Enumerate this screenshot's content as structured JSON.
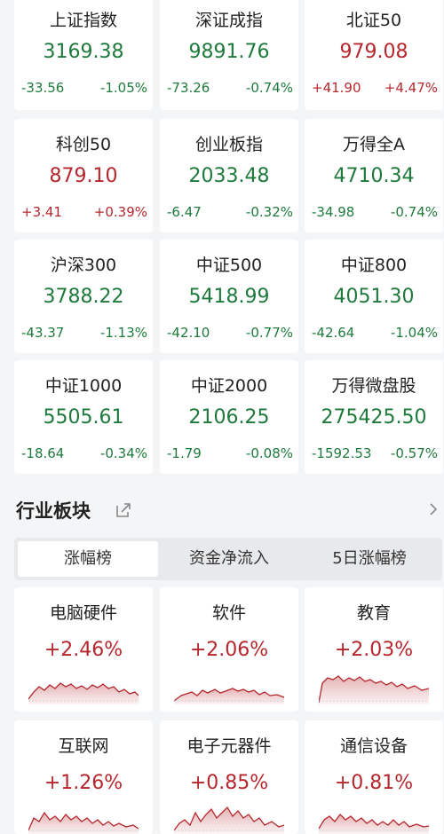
{
  "colors": {
    "up": "#b5272d",
    "down": "#1e7a3c",
    "background": "#f4f5f6"
  },
  "indices": [
    {
      "name": "上证指数",
      "value": "3169.38",
      "change": "-33.56",
      "pct": "-1.05%",
      "direction": "down"
    },
    {
      "name": "深证成指",
      "value": "9891.76",
      "change": "-73.26",
      "pct": "-0.74%",
      "direction": "down"
    },
    {
      "name": "北证50",
      "value": "979.08",
      "change": "+41.90",
      "pct": "+4.47%",
      "direction": "up"
    },
    {
      "name": "科创50",
      "value": "879.10",
      "change": "+3.41",
      "pct": "+0.39%",
      "direction": "up"
    },
    {
      "name": "创业板指",
      "value": "2033.48",
      "change": "-6.47",
      "pct": "-0.32%",
      "direction": "down"
    },
    {
      "name": "万得全A",
      "value": "4710.34",
      "change": "-34.98",
      "pct": "-0.74%",
      "direction": "down"
    },
    {
      "name": "沪深300",
      "value": "3788.22",
      "change": "-43.37",
      "pct": "-1.13%",
      "direction": "down"
    },
    {
      "name": "中证500",
      "value": "5418.99",
      "change": "-42.10",
      "pct": "-0.77%",
      "direction": "down"
    },
    {
      "name": "中证800",
      "value": "4051.30",
      "change": "-42.64",
      "pct": "-1.04%",
      "direction": "down"
    },
    {
      "name": "中证1000",
      "value": "5505.61",
      "change": "-18.64",
      "pct": "-0.34%",
      "direction": "down"
    },
    {
      "name": "中证2000",
      "value": "2106.25",
      "change": "-1.79",
      "pct": "-0.08%",
      "direction": "down"
    },
    {
      "name": "万得微盘股",
      "value": "275425.50",
      "change": "-1592.53",
      "pct": "-0.57%",
      "direction": "down"
    }
  ],
  "sector_section": {
    "title": "行业板块",
    "share_icon": "share-icon",
    "more_icon": "chevron-right-icon",
    "tabs": [
      "涨幅榜",
      "资金净流入",
      "5日涨幅榜"
    ],
    "active_tab": 0
  },
  "sectors": [
    {
      "name": "电脑硬件",
      "pct": "+2.46%",
      "direction": "up"
    },
    {
      "name": "软件",
      "pct": "+2.06%",
      "direction": "up"
    },
    {
      "name": "教育",
      "pct": "+2.03%",
      "direction": "up"
    },
    {
      "name": "互联网",
      "pct": "+1.26%",
      "direction": "up"
    },
    {
      "name": "电子元器件",
      "pct": "+0.85%",
      "direction": "up"
    },
    {
      "name": "通信设备",
      "pct": "+0.81%",
      "direction": "up"
    }
  ]
}
